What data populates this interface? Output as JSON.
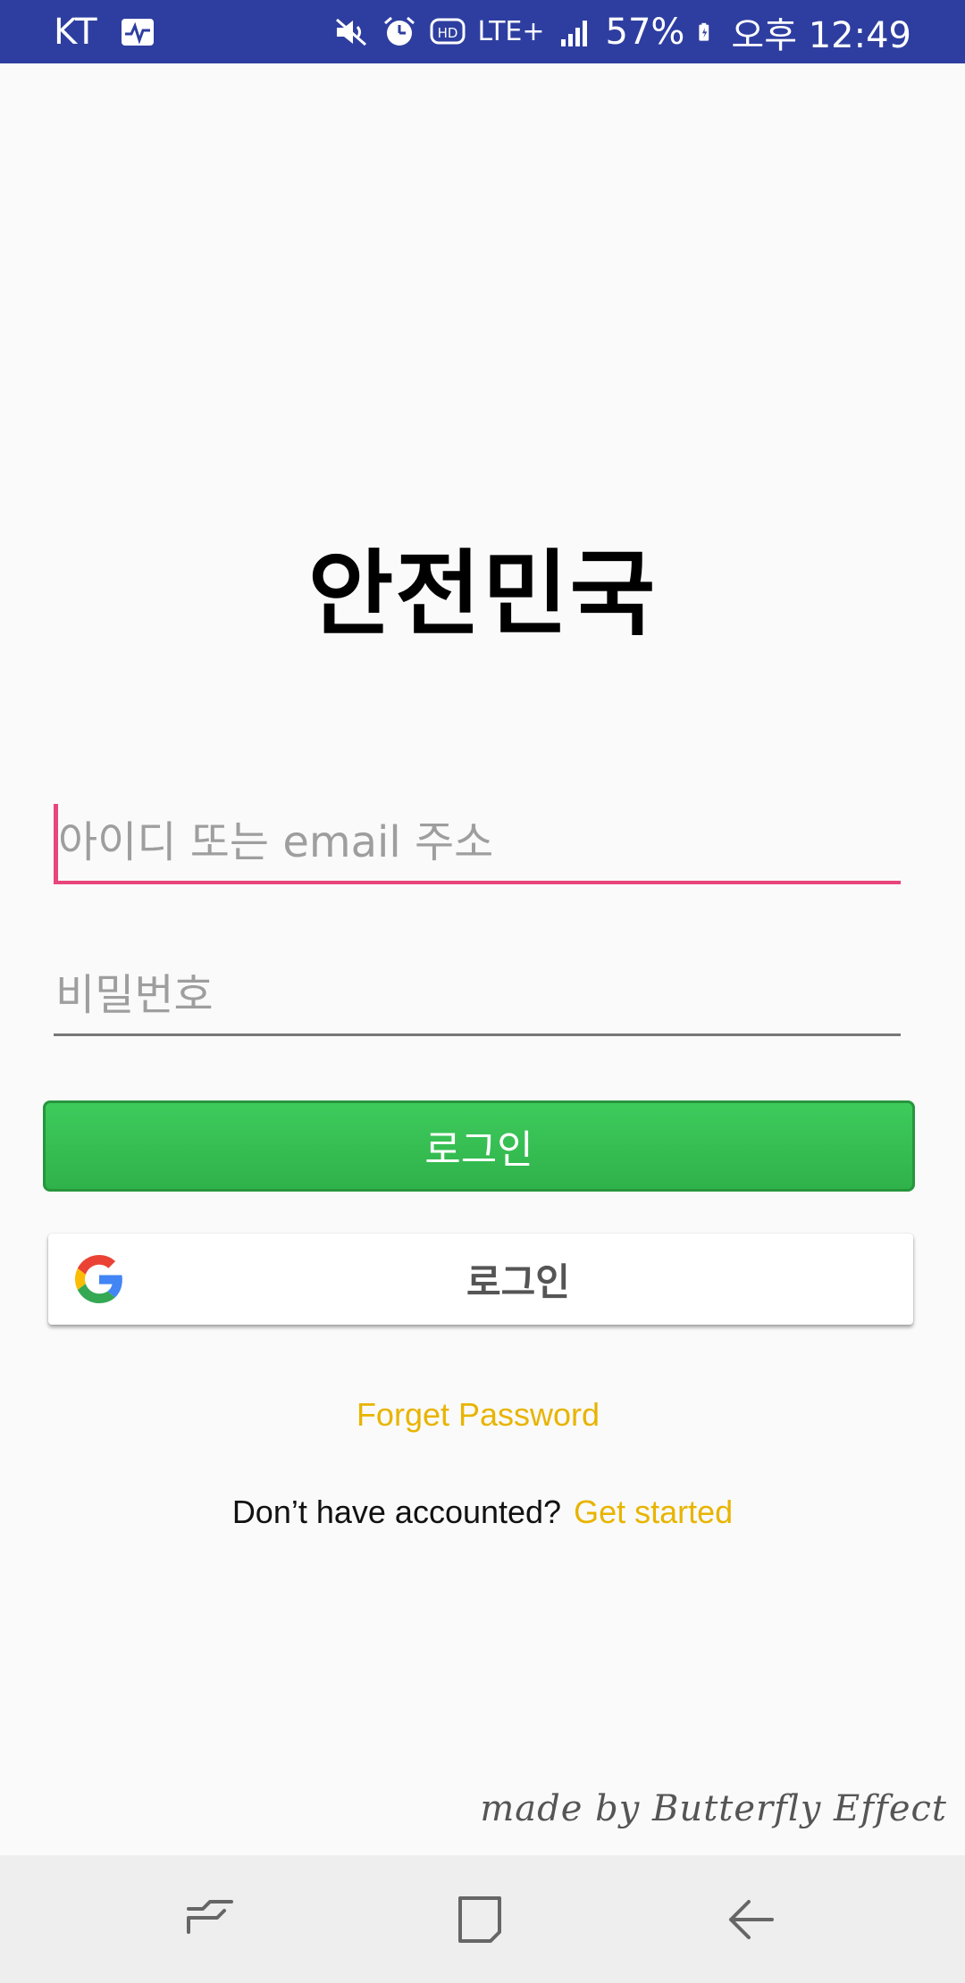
{
  "status_bar": {
    "carrier": "KT",
    "battery": "57%",
    "time": "오후 12:49",
    "network": "LTE+",
    "background_color": "#2e3ea0",
    "icons": [
      "activity-icon",
      "mute-icon",
      "alarm-icon",
      "hd-icon",
      "lte-icon",
      "signal-icon",
      "battery-icon"
    ]
  },
  "app": {
    "title": "안전민국"
  },
  "form": {
    "id_placeholder": "아이디 또는 email 주소",
    "password_placeholder": "비밀번호",
    "login_button": "로그인",
    "google_login_button": "로그인",
    "accent_color": "#e8457a",
    "button_color": "#3ecb5c"
  },
  "links": {
    "forget_password": "Forget Password",
    "no_account": "Don’t have accounted?",
    "get_started": "Get started",
    "link_color": "#e8b400"
  },
  "footer": {
    "credit": "made by Butterfly Effect"
  },
  "nav_bar": {
    "icons": [
      "recents-icon",
      "home-icon",
      "back-icon"
    ]
  }
}
